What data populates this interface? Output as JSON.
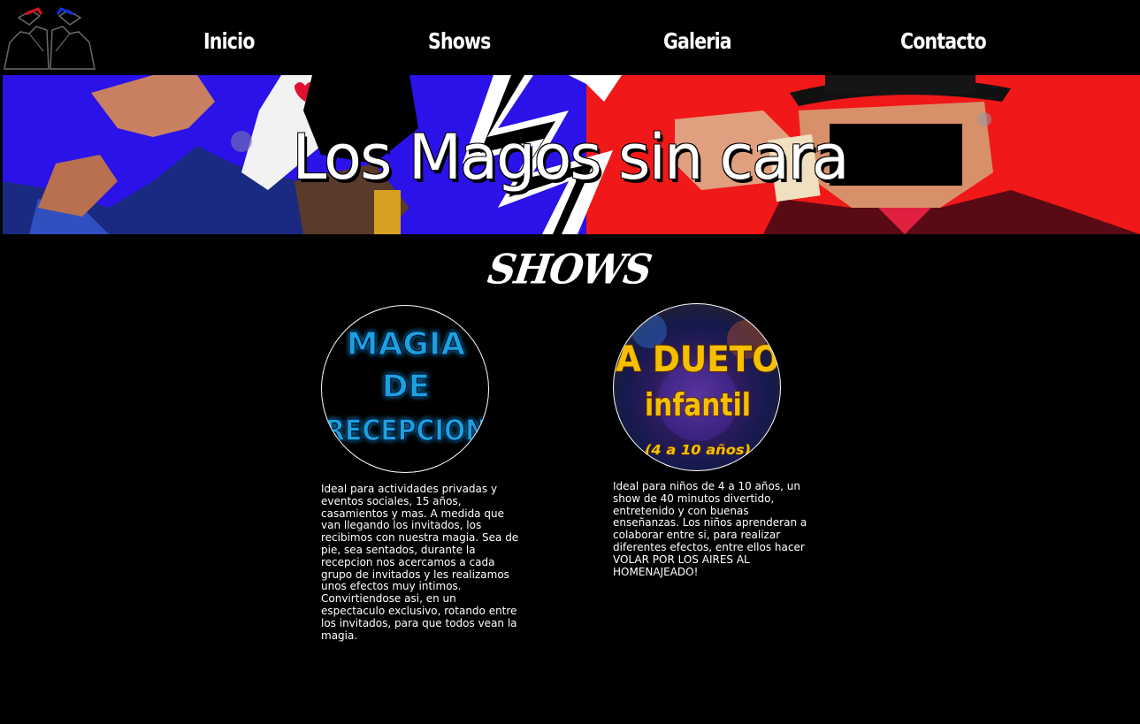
{
  "nav": {
    "items": [
      {
        "label": "Inicio"
      },
      {
        "label": "Shows"
      },
      {
        "label": "Galeria"
      },
      {
        "label": "Contacto"
      }
    ]
  },
  "banner": {
    "title": "Los Magos sin cara"
  },
  "section": {
    "title": "SHOWS"
  },
  "shows": [
    {
      "thumb_text": [
        "MAGIA",
        "DE",
        "RECEPCION"
      ],
      "description": "Ideal para actividades privadas y eventos sociales, 15 años, casamientos y mas. A medida que van llegando los invitados, los recibimos con nuestra magia. Sea de pie, sea sentados, durante la recepcion nos acercamos a cada grupo de invitados y les realizamos unos efectos muy intimos. Convirtiendose asi, en un espectaculo exclusivo, rotando entre los invitados, para que todos vean la magia."
    },
    {
      "thumb_text": [
        "A DUETO",
        "infantil",
        "(4 a 10 años)"
      ],
      "description": "Ideal para niños de 4 a 10 años, un show de 40 minutos divertido, entretenido y con buenas enseñanzas. Los niños aprenderan a colaborar entre si, para realizar diferentes efectos, entre ellos hacer VOLAR POR LOS AIRES AL HOMENAJEADO!"
    }
  ],
  "colors": {
    "background": "#000000",
    "banner_blue": "#2a12e8",
    "banner_red": "#f01818",
    "magia_text": "#1aa0e0",
    "dueto_text": "#f5c000"
  }
}
